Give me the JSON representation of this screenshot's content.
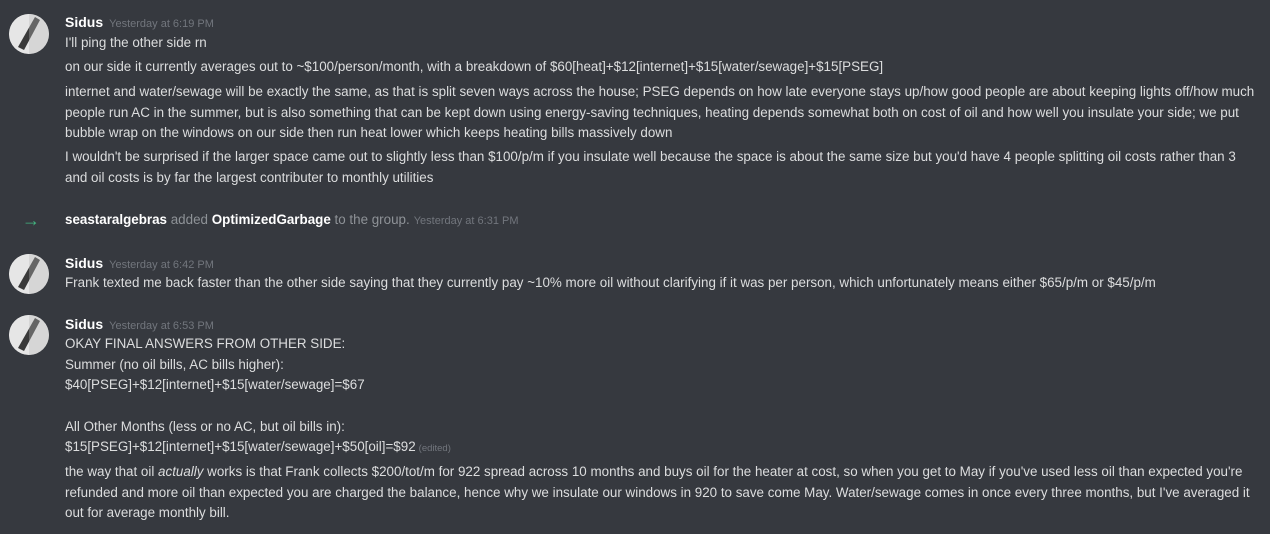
{
  "messages": [
    {
      "username": "Sidus",
      "timestamp": "Yesterday at 6:19 PM",
      "lines": [
        "I'll ping the other side rn",
        "on our side it currently averages out to ~$100/person/month, with a breakdown of $60[heat]+$12[internet]+$15[water/sewage]+$15[PSEG]",
        "internet and water/sewage will be exactly the same, as that is split seven ways across the house; PSEG depends on how late everyone stays up/how good people are about keeping lights off/how much people run AC in the summer, but is also something that can be kept down using energy-saving techniques, heating depends somewhat both on cost of oil and how well you insulate your side; we put bubble wrap on the windows on our side then run heat lower which keeps heating bills massively down",
        "I wouldn't be surprised if the larger space came out to slightly less than $100/p/m if you insulate well because the space is about the same size but you'd have 4 people splitting oil costs rather than 3 and oil costs is by far the largest contributer to monthly utilities"
      ]
    },
    {
      "username": "Sidus",
      "timestamp": "Yesterday at 6:42 PM",
      "lines": [
        "Frank texted me back faster than the other side saying that they currently pay ~10% more oil without clarifying if it was per person, which unfortunately means either $65/p/m or $45/p/m"
      ]
    },
    {
      "username": "Sidus",
      "timestamp": "Yesterday at 6:53 PM",
      "lines": [
        "OKAY FINAL ANSWERS FROM OTHER SIDE:",
        "Summer (no oil bills, AC bills higher):",
        "$40[PSEG]+$12[internet]+$15[water/sewage]=$67",
        "All Other Months (less or no AC, but oil bills in):",
        "$15[PSEG]+$12[internet]+$15[water/sewage]+$50[oil]=$92",
        "the way that oil ",
        "actually",
        " works is that Frank collects $200/tot/m for 922 spread across 10 months and buys oil for the heater at cost, so when you get to May if you've used less oil than expected you're refunded and more oil than expected you are charged the balance, hence why we insulate our windows in 920 to save come May. Water/sewage comes in once every three months, but I've averaged it out for average monthly bill."
      ],
      "edited_label": "(edited)"
    }
  ],
  "system_message": {
    "actor": "seastaralgebras",
    "action_pre": "added",
    "target": "OptimizedGarbage",
    "action_post": "to the group.",
    "timestamp": "Yesterday at 6:31 PM"
  },
  "colors": {
    "background": "#36393f",
    "username": "#ffffff",
    "text": "#dcddde",
    "timestamp": "#72767d",
    "join_arrow": "#43b581"
  },
  "icons": {
    "avatar": "avatar-icon",
    "join": "arrow-right-icon"
  }
}
